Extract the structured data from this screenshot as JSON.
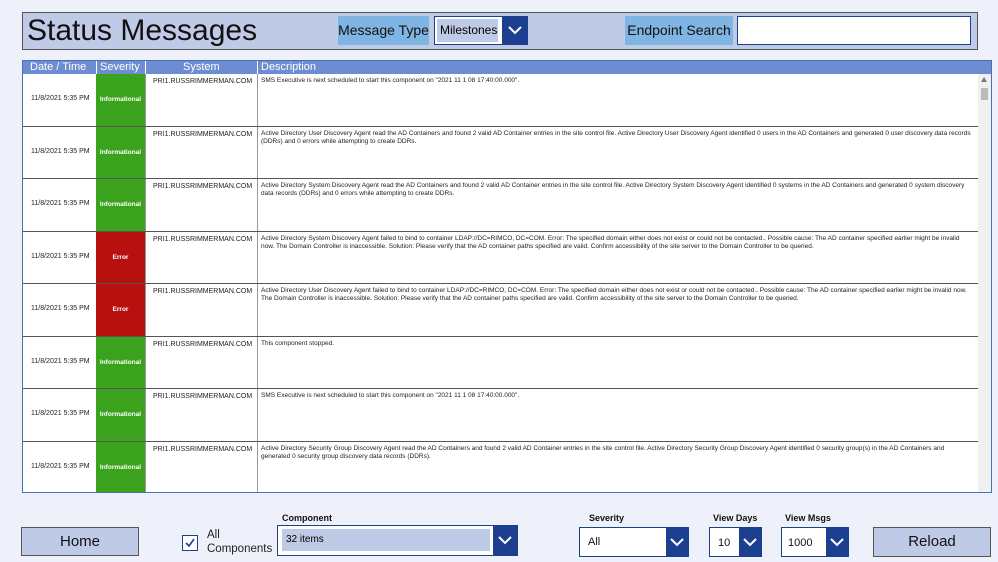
{
  "header": {
    "title": "Status Messages",
    "message_type_label": "Message Type",
    "message_type_value": "Milestones",
    "endpoint_search_label": "Endpoint Search",
    "endpoint_search_value": ""
  },
  "grid": {
    "columns": [
      "Date / Time",
      "Severity",
      "System",
      "Description"
    ],
    "rows": [
      {
        "date": "11/8/2021 5:35 PM",
        "severity": "Informational",
        "system": "PRI1.RUSSRIMMERMAN.COM",
        "description": "SMS Executive is next scheduled to start this component on \"2021 11 1 08 17:40:00.000\"."
      },
      {
        "date": "11/8/2021 5:35 PM",
        "severity": "Informational",
        "system": "PRI1.RUSSRIMMERMAN.COM",
        "description": "Active Directory User Discovery Agent read the AD Containers and found 2 valid AD Container entries in the site control file.  Active Directory User Discovery Agent identified 0 users in the AD Containers and generated 0 user discovery data records (DDRs) and 0 errors while attempting to create DDRs."
      },
      {
        "date": "11/8/2021 5:35 PM",
        "severity": "Informational",
        "system": "PRI1.RUSSRIMMERMAN.COM",
        "description": "Active Directory System Discovery Agent read the AD Containers and found 2 valid AD Container entries in the site control file.  Active Directory System Discovery Agent identified 0 systems in the AD Containers and generated 0 system discovery data records (DDRs) and 0 errors while attempting to create DDRs."
      },
      {
        "date": "11/8/2021 5:35 PM",
        "severity": "Error",
        "system": "PRI1.RUSSRIMMERMAN.COM",
        "description": "Active Directory System Discovery Agent failed to bind to container LDAP://DC=RIMCO, DC=COM. Error: The specified domain either does not exist or could not be contacted..  Possible cause: The AD container specified earlier might be invalid now. The Domain Controller is inaccessible. Solution: Please verify that the AD container paths specified are valid. Confirm accessibility of the site server to the Domain Controller to be queried."
      },
      {
        "date": "11/8/2021 5:35 PM",
        "severity": "Error",
        "system": "PRI1.RUSSRIMMERMAN.COM",
        "description": "Active Directory User Discovery Agent failed to bind to container LDAP://DC=RIMCO, DC=COM. Error: The specified domain either does not exist or could not be contacted..  Possible cause: The AD container specified earlier might be invalid now. The Domain Controller is inaccessible. Solution: Please verify that the AD container paths specified are valid. Confirm accessibility of the site server to the Domain Controller to be queried."
      },
      {
        "date": "11/8/2021 5:35 PM",
        "severity": "Informational",
        "system": "PRI1.RUSSRIMMERMAN.COM",
        "description": "This component stopped."
      },
      {
        "date": "11/8/2021 5:35 PM",
        "severity": "Informational",
        "system": "PRI1.RUSSRIMMERMAN.COM",
        "description": "SMS Executive is next scheduled to start this component on \"2021 11 1 08 17:40:00.000\"."
      },
      {
        "date": "11/8/2021 5:35 PM",
        "severity": "Informational",
        "system": "PRI1.RUSSRIMMERMAN.COM",
        "description": "Active Directory Security Group Discovery Agent read the AD Containers and found 2 valid AD Container entries in the site control file.  Active Directory Security Group Discovery Agent identified 0 security group(s) in the AD Containers and generated 0 security group discovery data records (DDRs)."
      }
    ]
  },
  "footer": {
    "home_label": "Home",
    "all_components_label": "All Components",
    "all_components_checked": true,
    "component_label": "Component",
    "component_value": "32 items",
    "severity_label": "Severity",
    "severity_value": "All",
    "view_days_label": "View Days",
    "view_days_value": "10",
    "view_msgs_label": "View Msgs",
    "view_msgs_value": "1000",
    "reload_label": "Reload"
  },
  "colors": {
    "informational": "#3aa21c",
    "error": "#b80f0f",
    "accent": "#1d3f8f",
    "header_bg": "#bfcbe6",
    "grid_header": "#6d8cd1"
  },
  "icons": [
    "chevron-down-icon",
    "checkmark-icon",
    "scroll-up-icon"
  ]
}
